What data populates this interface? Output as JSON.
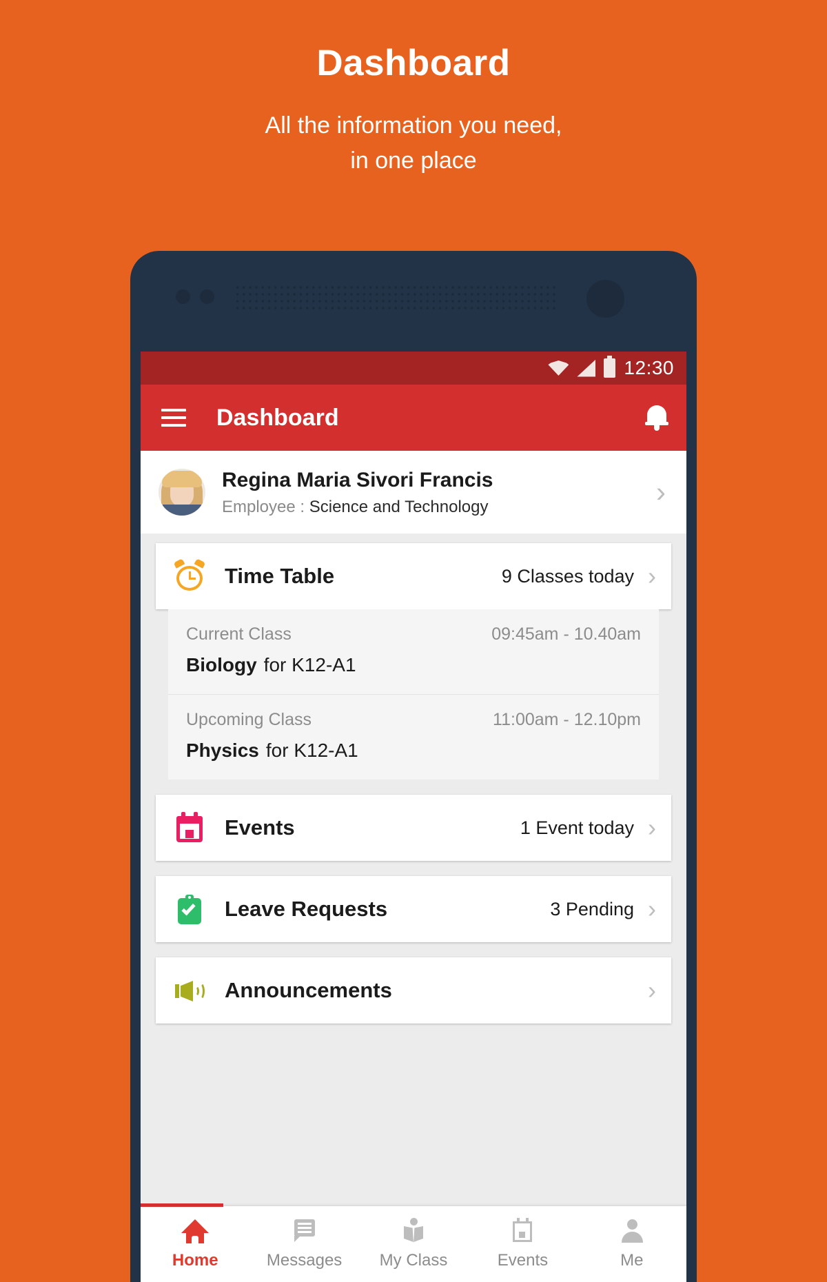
{
  "promo": {
    "title": "Dashboard",
    "subtitle_line1": "All the information you need,",
    "subtitle_line2": "in one place"
  },
  "colors": {
    "background_orange": "#E8621F",
    "phone_frame": "#223347",
    "statusbar_red": "#A42424",
    "appbar_red": "#D32F2F",
    "accent_red": "#E03A30",
    "icon_alarm_orange": "#F5A623",
    "icon_calendar_pink": "#E91E63",
    "icon_clipboard_green": "#2EBD6B",
    "icon_megaphone_olive": "#A8AD1F"
  },
  "statusbar": {
    "time": "12:30",
    "icons": [
      "wifi-icon",
      "signal-icon",
      "battery-icon"
    ]
  },
  "appbar": {
    "menu_icon": "hamburger-menu-icon",
    "title": "Dashboard",
    "notification_icon": "bell-icon"
  },
  "profile": {
    "avatar": "user-avatar",
    "name": "Regina Maria Sivori Francis",
    "role_label": "Employee :",
    "department": "Science and Technology",
    "chevron": "›"
  },
  "cards": [
    {
      "key": "time-table",
      "icon": "alarm-clock-icon",
      "title": "Time Table",
      "meta": "9 Classes today",
      "chevron": "›"
    },
    {
      "key": "events",
      "icon": "calendar-icon",
      "title": "Events",
      "meta": "1 Event today",
      "chevron": "›"
    },
    {
      "key": "leave-requests",
      "icon": "clipboard-check-icon",
      "title": "Leave Requests",
      "meta": "3 Pending",
      "chevron": "›"
    },
    {
      "key": "announcements",
      "icon": "megaphone-icon",
      "title": "Announcements",
      "meta": "",
      "chevron": "›"
    }
  ],
  "timetable_detail": [
    {
      "label": "Current Class",
      "time": "09:45am - 10.40am",
      "subject": "Biology",
      "for": "for K12-A1"
    },
    {
      "label": "Upcoming Class",
      "time": "11:00am - 12.10pm",
      "subject": "Physics",
      "for": "for K12-A1"
    }
  ],
  "bottom_nav": [
    {
      "key": "home",
      "icon": "home-icon",
      "label": "Home",
      "active": true
    },
    {
      "key": "messages",
      "icon": "message-icon",
      "label": "Messages",
      "active": false
    },
    {
      "key": "my-class",
      "icon": "book-icon",
      "label": "My Class",
      "active": false
    },
    {
      "key": "events",
      "icon": "calendar-icon",
      "label": "Events",
      "active": false
    },
    {
      "key": "me",
      "icon": "person-icon",
      "label": "Me",
      "active": false
    }
  ]
}
